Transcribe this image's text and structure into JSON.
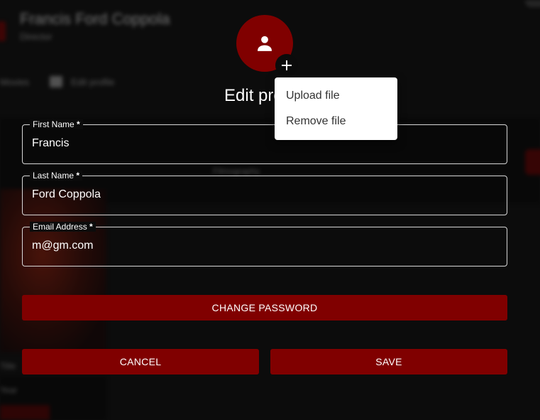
{
  "background": {
    "app_title": "Francis Ford Coppola",
    "app_subtitle": "Director",
    "nav_left": "Movies",
    "nav_right": "Edit profile",
    "mid_text": "Filmography",
    "bottom_text_1": "Title",
    "bottom_text_2": "Year"
  },
  "dialog": {
    "avatar_icon": "person-icon",
    "add_icon": "plus-icon",
    "title": "Edit profile",
    "fields": {
      "first_name": {
        "label": "First Name",
        "required_mark": " *",
        "value": "Francis"
      },
      "last_name": {
        "label": "Last Name",
        "required_mark": " *",
        "value": "Ford Coppola"
      },
      "email": {
        "label": "Email Address",
        "required_mark": " *",
        "value": "m@gm.com"
      }
    },
    "change_password_label": "CHANGE PASSWORD",
    "cancel_label": "CANCEL",
    "save_label": "SAVE"
  },
  "file_menu": {
    "items": [
      {
        "label": "Upload file"
      },
      {
        "label": "Remove file"
      }
    ]
  },
  "colors": {
    "accent": "#800000",
    "background": "#0c0c0c",
    "menu_background": "#ffffff"
  }
}
